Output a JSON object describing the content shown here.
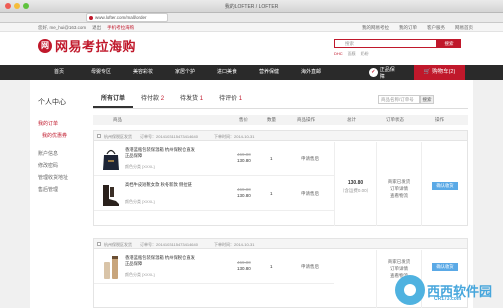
{
  "window": {
    "title": "我的LOFTER / LOFTER",
    "address": "www.lofter.com/mall/order"
  },
  "topbar": {
    "greeting": "您好, me_hui@163.com",
    "logout": "退出",
    "mobile_link": "手机考拉海购",
    "right_links": [
      "我的网易考拉",
      "我的订单",
      "客户服务",
      "网易首页"
    ]
  },
  "header": {
    "logo_mark": "网",
    "logo_text": "网易考拉海购",
    "search_placeholder": "搜索",
    "search_button": "搜索",
    "hot_words": [
      "DHC",
      "面膜",
      "奶粉"
    ]
  },
  "nav": {
    "items": [
      "首页",
      "母婴专区",
      "美容彩妆",
      "家居个护",
      "进口美食",
      "营养保健",
      "海外直邮"
    ],
    "guarantee": "正品保障",
    "cart": "购物车(2)"
  },
  "sidebar": {
    "title": "个人中心",
    "groups": [
      [
        "我的订单",
        "我的优惠券"
      ],
      [
        "账户信息",
        "修改密码",
        "管理收货地址"
      ],
      [
        "售后管理"
      ]
    ]
  },
  "tabs": [
    {
      "label": "所有订单",
      "count": ""
    },
    {
      "label": "待付款",
      "count": "2"
    },
    {
      "label": "待发货",
      "count": "1"
    },
    {
      "label": "待评价",
      "count": "1"
    }
  ],
  "order_search": {
    "placeholder": "商品名称/订单号",
    "button": "搜索"
  },
  "table_headers": {
    "product": "商品",
    "price": "售价",
    "qty": "数量",
    "op": "商品操作",
    "total": "总计",
    "status": "订单状态",
    "action": "操作"
  },
  "orders": [
    {
      "store": "杭州保税区发货",
      "order_no": "订单号：2014103115473414640",
      "time": "下单时间：2014-10-31",
      "items": [
        {
          "title": "香港蓝瓶包装保温箱 杭州保税仓直发 正品保障",
          "spec": "颜色分类 [XXXL]",
          "price_old": "469.00",
          "price": "130.80",
          "qty": "1",
          "op": "申请售后",
          "icon": "handbag-image"
        },
        {
          "title": "高档牛皮短靴女款 秋冬新款 侧拉链",
          "spec": "颜色分类 [XXXL]",
          "price_old": "469.00",
          "price": "130.80",
          "qty": "1",
          "op": "申请售后",
          "icon": "boots-image"
        }
      ],
      "total": "130.80",
      "shipping": "（含运费0.00）",
      "status": [
        "商家已发货",
        "订单详情",
        "查看物流"
      ],
      "action": "确认收货"
    },
    {
      "store": "杭州保税区发货",
      "order_no": "订单号：2014103115473414640",
      "time": "下单时间：2014-10-31",
      "items": [
        {
          "title": "香港蓝瓶包装保温箱 杭州保税仓直发 正品保障",
          "spec": "颜色分类 [XXXL]",
          "price_old": "469.00",
          "price": "130.80",
          "qty": "1",
          "op": "申请售后",
          "icon": "cosmetics-image"
        }
      ],
      "total": "",
      "shipping": "",
      "status": [
        "商家已发货",
        "订单详情",
        "查看物流"
      ],
      "action": "确认收货"
    }
  ],
  "watermark": {
    "text": "西西软件园",
    "sub": "CR173.com"
  },
  "colors": {
    "brand": "#c0182b",
    "nav": "#2a2a2a",
    "button": "#5aa9e6"
  }
}
